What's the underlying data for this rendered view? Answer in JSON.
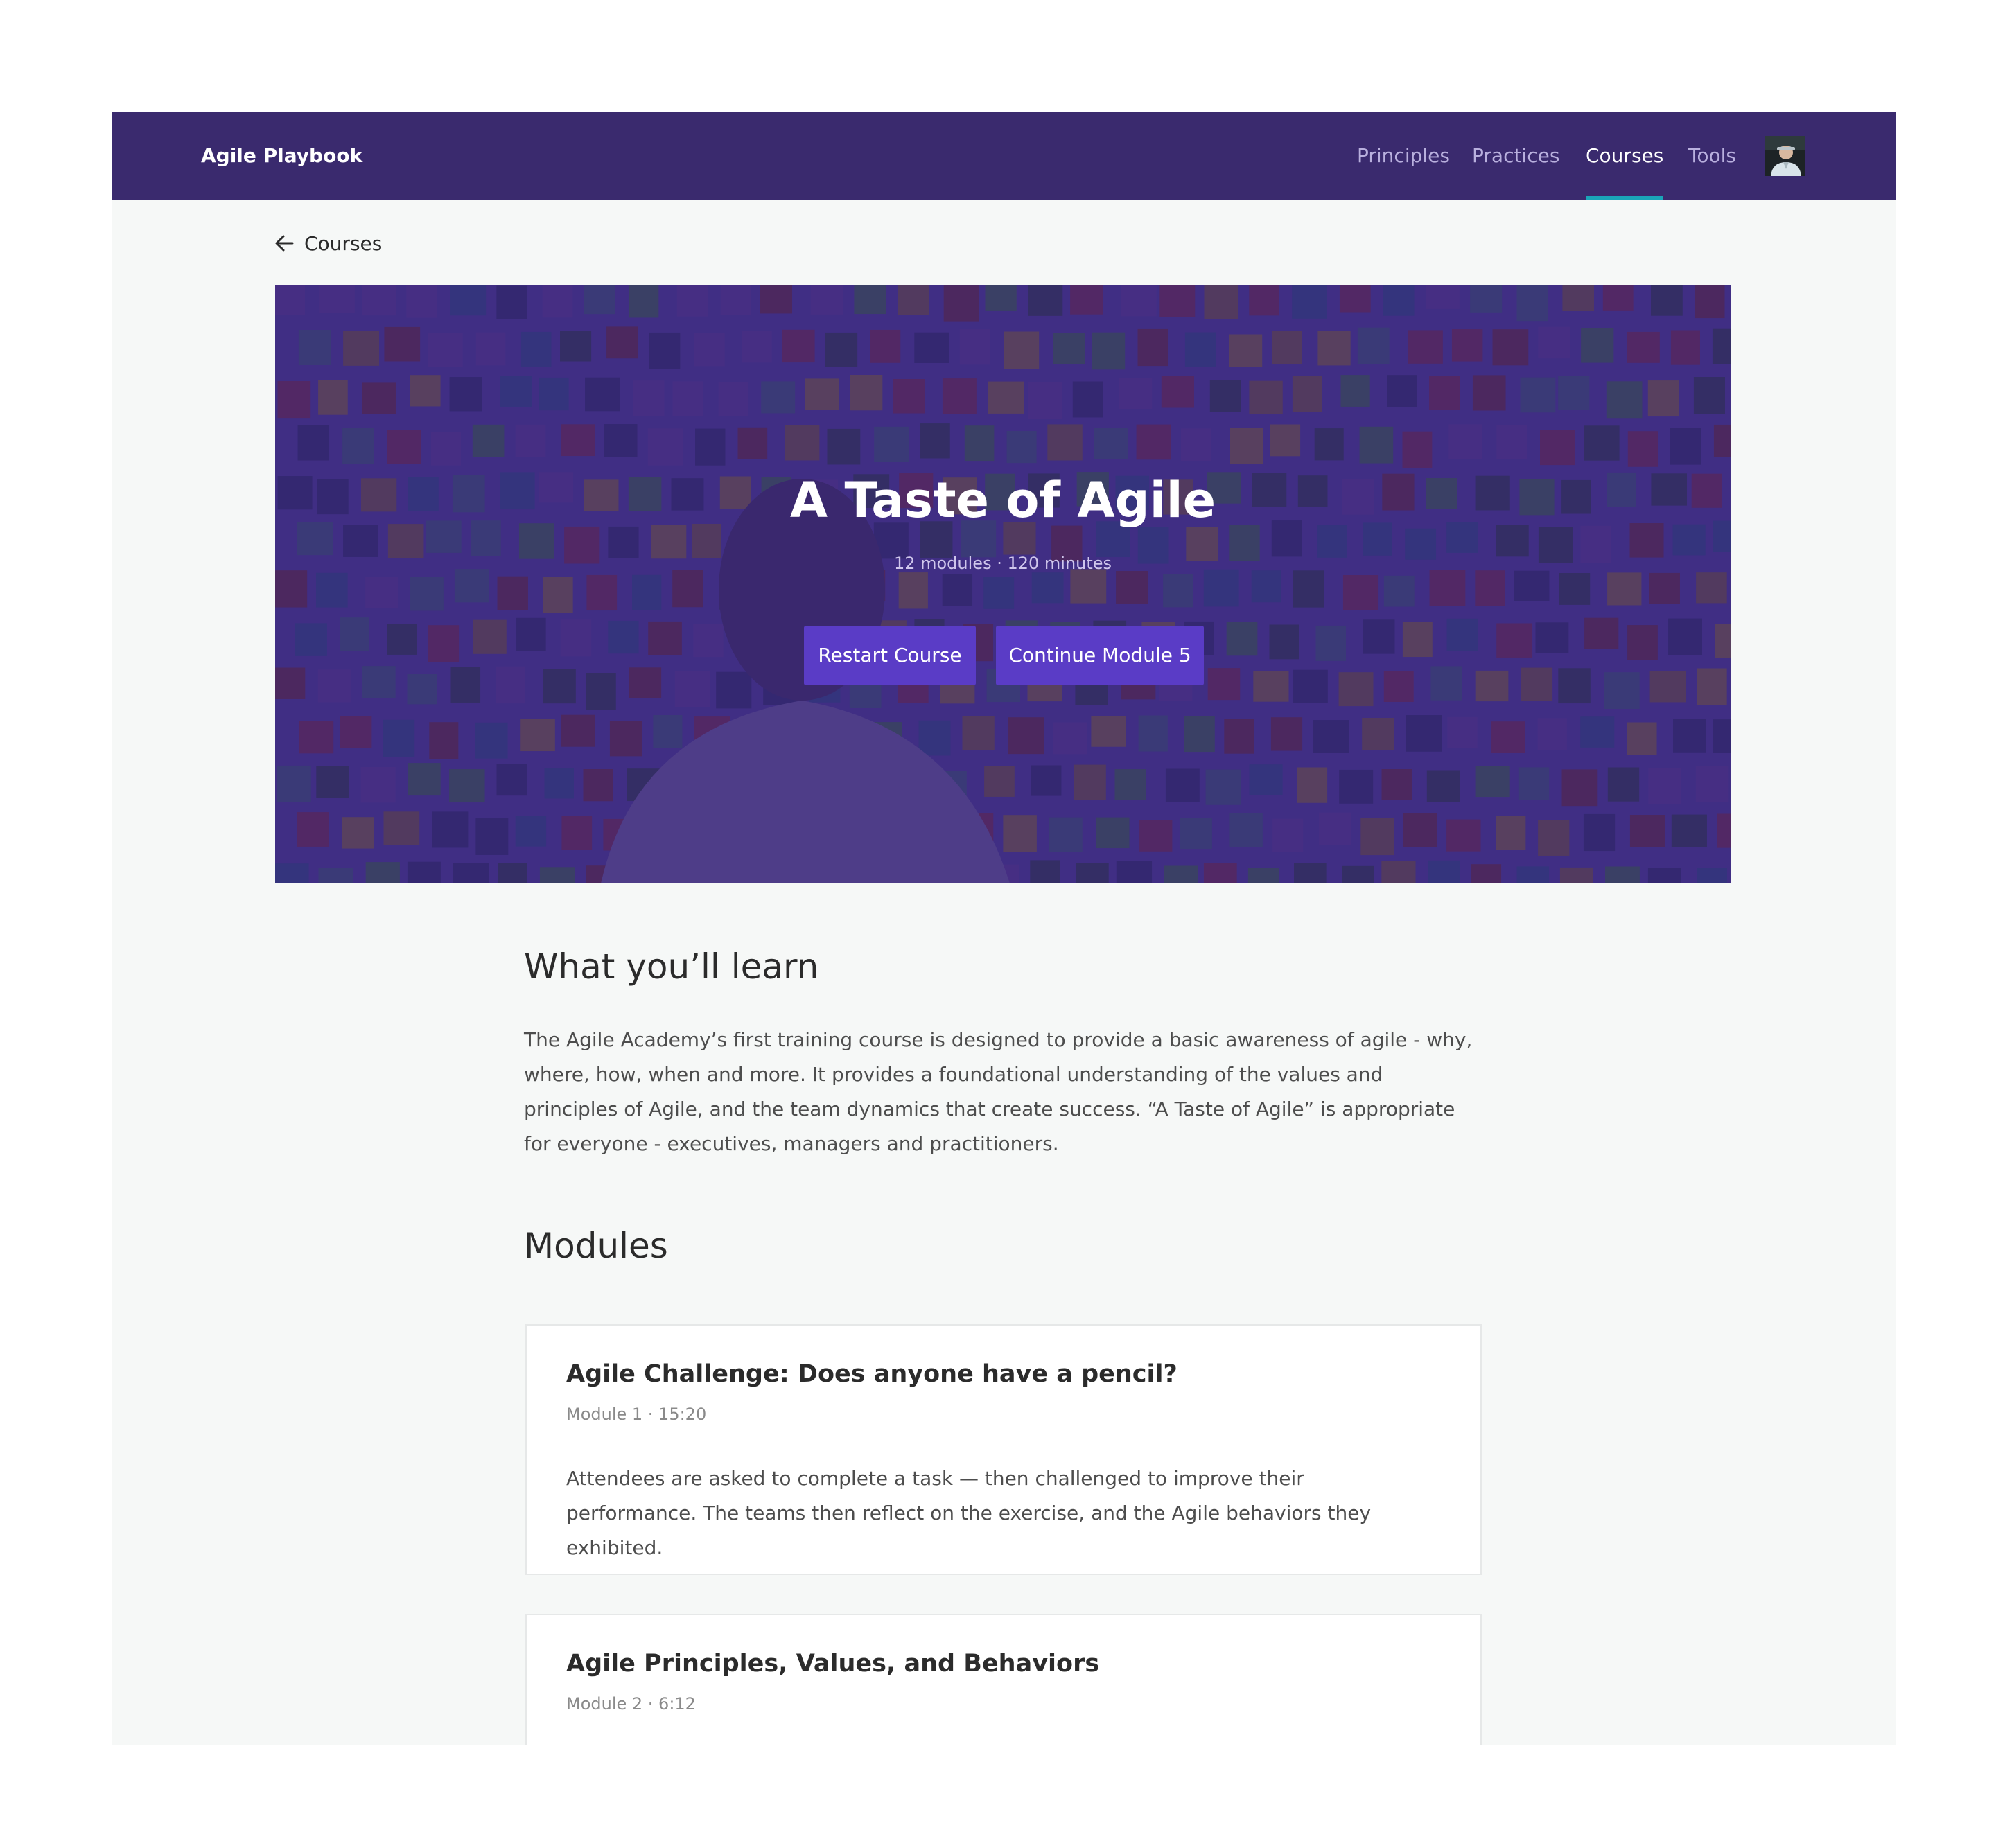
{
  "app": {
    "title": "Agile Playbook"
  },
  "nav": {
    "items": [
      {
        "label": "Principles",
        "active": false
      },
      {
        "label": "Practices",
        "active": false
      },
      {
        "label": "Courses",
        "active": true
      },
      {
        "label": "Tools",
        "active": false
      }
    ],
    "avatar_icon": "user-avatar"
  },
  "breadcrumb": {
    "back_label": "Courses",
    "icon": "arrow-left-icon"
  },
  "hero": {
    "title": "A Taste of Agile",
    "meta": "12 modules · 120 minutes",
    "restart_label": "Restart Course",
    "continue_label": "Continue Module 5"
  },
  "learn": {
    "heading": "What you’ll learn",
    "description": "The Agile Academy’s first training course is designed to provide a basic awareness of agile - why, where, how, when and more. It provides a foundational understanding of the values and principles of Agile, and the team dynamics that create success. “A Taste of Agile” is appropriate for everyone - executives, managers and practitioners."
  },
  "modules": {
    "heading": "Modules",
    "items": [
      {
        "title": "Agile Challenge: Does anyone have a pencil?",
        "meta": "Module 1 · 15:20",
        "description": "Attendees are asked to complete a task — then challenged to improve their performance. The teams then reflect on the exercise, and the Agile behaviors they exhibited."
      },
      {
        "title": "Agile Principles, Values, and Behaviors",
        "meta": "Module 2 · 6:12",
        "description": ""
      }
    ]
  },
  "colors": {
    "nav_bg": "#3a2a6e",
    "accent": "#5a3cc6",
    "active_underline": "#1aa5b8",
    "page_bg": "#f6f8f7"
  }
}
